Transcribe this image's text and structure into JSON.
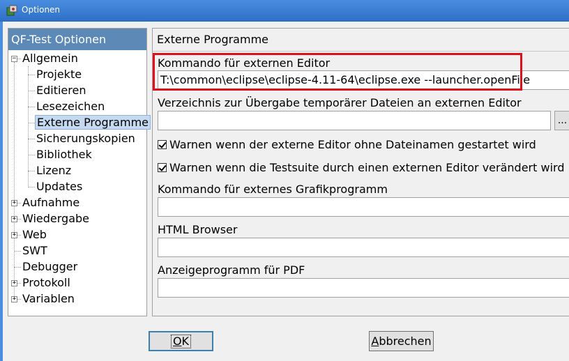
{
  "window": {
    "title": "Optionen",
    "icon": "qftest-app-icon"
  },
  "tree": {
    "header": "QF-Test Optionen",
    "items": [
      {
        "label": "Allgemein",
        "level": 0,
        "expander": "minus"
      },
      {
        "label": "Projekte",
        "level": 1
      },
      {
        "label": "Editieren",
        "level": 1
      },
      {
        "label": "Lesezeichen",
        "level": 1
      },
      {
        "label": "Externe Programme",
        "level": 1,
        "selected": true
      },
      {
        "label": "Sicherungskopien",
        "level": 1
      },
      {
        "label": "Bibliothek",
        "level": 1
      },
      {
        "label": "Lizenz",
        "level": 1
      },
      {
        "label": "Updates",
        "level": 1
      },
      {
        "label": "Aufnahme",
        "level": 0,
        "expander": "plus"
      },
      {
        "label": "Wiedergabe",
        "level": 0,
        "expander": "plus"
      },
      {
        "label": "Web",
        "level": 0,
        "expander": "plus"
      },
      {
        "label": "SWT",
        "level": 0
      },
      {
        "label": "Debugger",
        "level": 0
      },
      {
        "label": "Protokoll",
        "level": 0,
        "expander": "plus"
      },
      {
        "label": "Variablen",
        "level": 0,
        "expander": "plus"
      }
    ]
  },
  "content": {
    "section_title": "Externe Programme",
    "editor_command": {
      "label": "Kommando für externen Editor",
      "value": "T:\\common\\eclipse\\eclipse-4.11-64\\eclipse.exe --launcher.openFile"
    },
    "temp_dir": {
      "label": "Verzeichnis zur Übergabe temporärer Dateien an externen Editor",
      "value": "",
      "browse_label": "..."
    },
    "warn_no_filename": {
      "label": "Warnen wenn der externe Editor ohne Dateinamen gestartet wird",
      "checked": true
    },
    "warn_modified": {
      "label": "Warnen wenn die Testsuite durch einen externen Editor verändert wird",
      "checked": true
    },
    "graphics_command": {
      "label": "Kommando für externes Grafikprogramm",
      "value": ""
    },
    "html_browser": {
      "label": "HTML Browser",
      "value": ""
    },
    "pdf_viewer": {
      "label": "Anzeigeprogramm für PDF",
      "value": ""
    }
  },
  "buttons": {
    "ok": "OK",
    "cancel": "Abbrechen"
  },
  "colors": {
    "titlebar": "#3a7fd6",
    "tree_header": "#5d89b7",
    "highlight_border": "#e0101a",
    "selection": "#c5d9f0"
  }
}
